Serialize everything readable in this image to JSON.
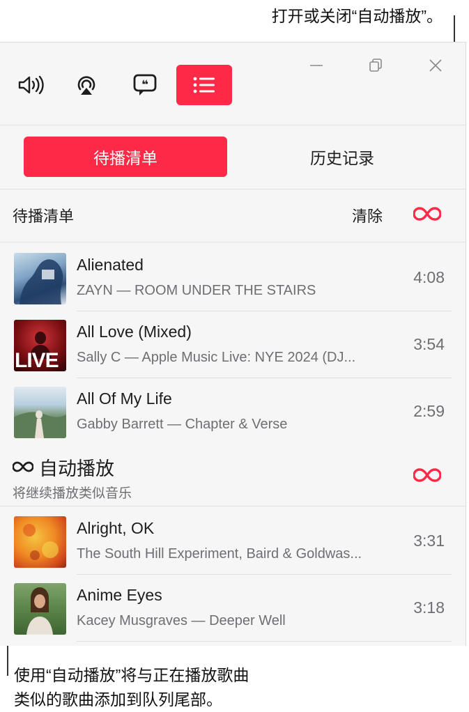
{
  "callouts": {
    "top": "打开或关闭“自动播放”。",
    "bottom_line1": "使用“自动播放”将与正在播放歌曲",
    "bottom_line2": "类似的歌曲添加到队列尾部。"
  },
  "toolbar": {
    "icons": [
      "volume-icon",
      "airplay-icon",
      "lyrics-icon",
      "queue-list-icon"
    ],
    "active": "queue-list-icon",
    "window_controls": [
      "minimize-icon",
      "restore-icon",
      "close-icon"
    ]
  },
  "tabs": [
    {
      "label": "待播清单",
      "selected": true
    },
    {
      "label": "历史记录",
      "selected": false
    }
  ],
  "queue": {
    "heading": "待播清单",
    "clear_label": "清除",
    "autoplay_icon": "infinity-icon",
    "songs": [
      {
        "title": "Alienated",
        "subtitle": "ZAYN — ROOM UNDER THE STAIRS",
        "duration": "4:08"
      },
      {
        "title": "All Love (Mixed)",
        "subtitle": "Sally C — Apple Music Live: NYE 2024 (DJ...",
        "duration": "3:54",
        "art_text": "LIVE"
      },
      {
        "title": "All Of My Life",
        "subtitle": "Gabby Barrett — Chapter & Verse",
        "duration": "2:59"
      }
    ]
  },
  "autoplay": {
    "title": "自动播放",
    "subtitle": "将继续播放类似音乐",
    "songs": [
      {
        "title": "Alright, OK",
        "subtitle": "The South Hill Experiment, Baird & Goldwas...",
        "duration": "3:31"
      },
      {
        "title": "Anime Eyes",
        "subtitle": "Kacey Musgraves — Deeper Well",
        "duration": "3:18"
      }
    ]
  },
  "colors": {
    "accent": "#fc2a46",
    "text": "#1d1d1f",
    "secondary": "#6e6e73"
  }
}
